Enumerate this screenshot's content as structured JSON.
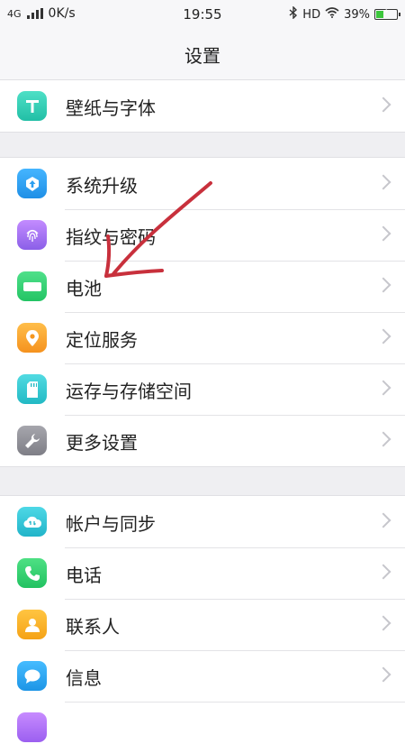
{
  "status_bar": {
    "network": "4G",
    "speed": "0K/s",
    "time": "19:55",
    "hd": "HD",
    "battery_percent": "39%",
    "battery_level": 0.39
  },
  "header": {
    "title": "设置"
  },
  "groups": [
    {
      "items": [
        {
          "label": "壁纸与字体",
          "icon": "text-T-icon",
          "color": "#2ccfb4"
        }
      ]
    },
    {
      "items": [
        {
          "label": "系统升级",
          "icon": "upgrade-icon",
          "color": "#2fa1f2"
        },
        {
          "label": "指纹与密码",
          "icon": "fingerprint-icon",
          "color": "#a574f4"
        },
        {
          "label": "电池",
          "icon": "battery-icon",
          "color": "#37d275"
        },
        {
          "label": "定位服务",
          "icon": "location-pin-icon",
          "color": "#f8a532"
        },
        {
          "label": "运存与存储空间",
          "icon": "storage-card-icon",
          "color": "#37cad3"
        },
        {
          "label": "更多设置",
          "icon": "wrench-icon",
          "color": "#93939a"
        }
      ]
    },
    {
      "items": [
        {
          "label": "帐户与同步",
          "icon": "cloud-sync-icon",
          "color": "#2fc6d8"
        },
        {
          "label": "电话",
          "icon": "phone-icon",
          "color": "#35d171"
        },
        {
          "label": "联系人",
          "icon": "contact-icon",
          "color": "#f8b42a"
        },
        {
          "label": "信息",
          "icon": "message-bubble-icon",
          "color": "#30a8f2"
        }
      ]
    }
  ]
}
